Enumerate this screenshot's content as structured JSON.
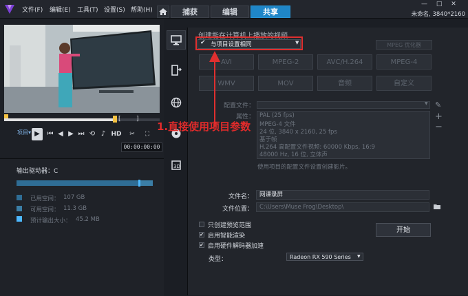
{
  "menu": [
    "文件(F)",
    "编辑(E)",
    "工具(T)",
    "设置(S)",
    "帮助(H)"
  ],
  "tabs": {
    "capture": "捕获",
    "edit": "编辑",
    "share": "共享"
  },
  "project_info": "未命名, 3840*2160",
  "window_controls": [
    "—",
    "□",
    "✕"
  ],
  "player": {
    "project_label": "项目▾",
    "hd": "HD",
    "timecode": "00:00:00:00"
  },
  "drive": {
    "label": "输出驱动器：C",
    "used_label": "已用空间：",
    "used_value": "107 GB",
    "free_label": "可用空间：",
    "free_value": "11.3 GB",
    "output_label": "预计输出大小：",
    "output_value": "45.2 MB",
    "colors": {
      "used": "#2f6d95",
      "free": "#3b7ea6",
      "output": "#4db8ff"
    }
  },
  "main": {
    "title": "创建能在计算机上播放的视频",
    "preset_value": "与项目设置相同",
    "mpeg_opt": "MPEG 优化器",
    "formats_row1": [
      "AVI",
      "MPEG-2",
      "AVC/H.264",
      "MPEG-4"
    ],
    "formats_row2": [
      "WMV",
      "MOV",
      "音频",
      "自定义"
    ],
    "config_label": "配置文件：",
    "props_label": "属性：",
    "props_lines": [
      "PAL (25 fps)",
      "MPEG-4 文件",
      "24 位, 3840 x 2160, 25 fps",
      "基于帧",
      "H.264 高配置文件视频: 60000 Kbps, 16:9",
      "48000 Hz, 16 位, 立体声"
    ],
    "props_note": "使用项目的配置文件设置创建影片。",
    "filename_label": "文件名：",
    "filename_value": "网课录屏",
    "location_label": "文件位置：",
    "location_value": "C:\\Users\\Muse Frog\\Desktop\\",
    "opt_preview": "只创建预览范围",
    "opt_smart": "启用智能渲染",
    "opt_hw": "启用硬件解码器加速",
    "start": "开始",
    "type_label": "类型：",
    "gpu_value": "Radeon RX 590 Series"
  },
  "annotation": "1.直接使用项目参数"
}
